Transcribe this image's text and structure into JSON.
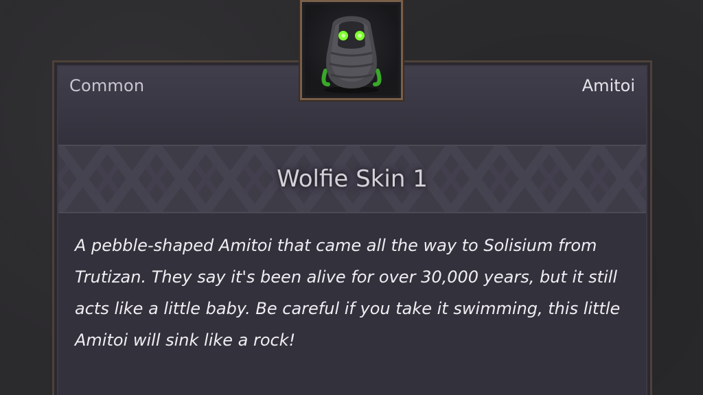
{
  "item": {
    "rarity": "Common",
    "category": "Amitoi",
    "name": "Wolfie Skin 1",
    "description": "A pebble-shaped Amitoi that came all the way to Solisium from Trutizan. They say it's been alive for over 30,000 years, but it still acts like a little baby. Be careful if you take it swimming, this little Amitoi will sink like a rock!",
    "portrait_icon": "amitoi-stone-creature"
  },
  "colors": {
    "background": "#2b2a2d",
    "card": "#33313c",
    "frame": "#7a5f49",
    "eyes": "#7cff2e"
  }
}
